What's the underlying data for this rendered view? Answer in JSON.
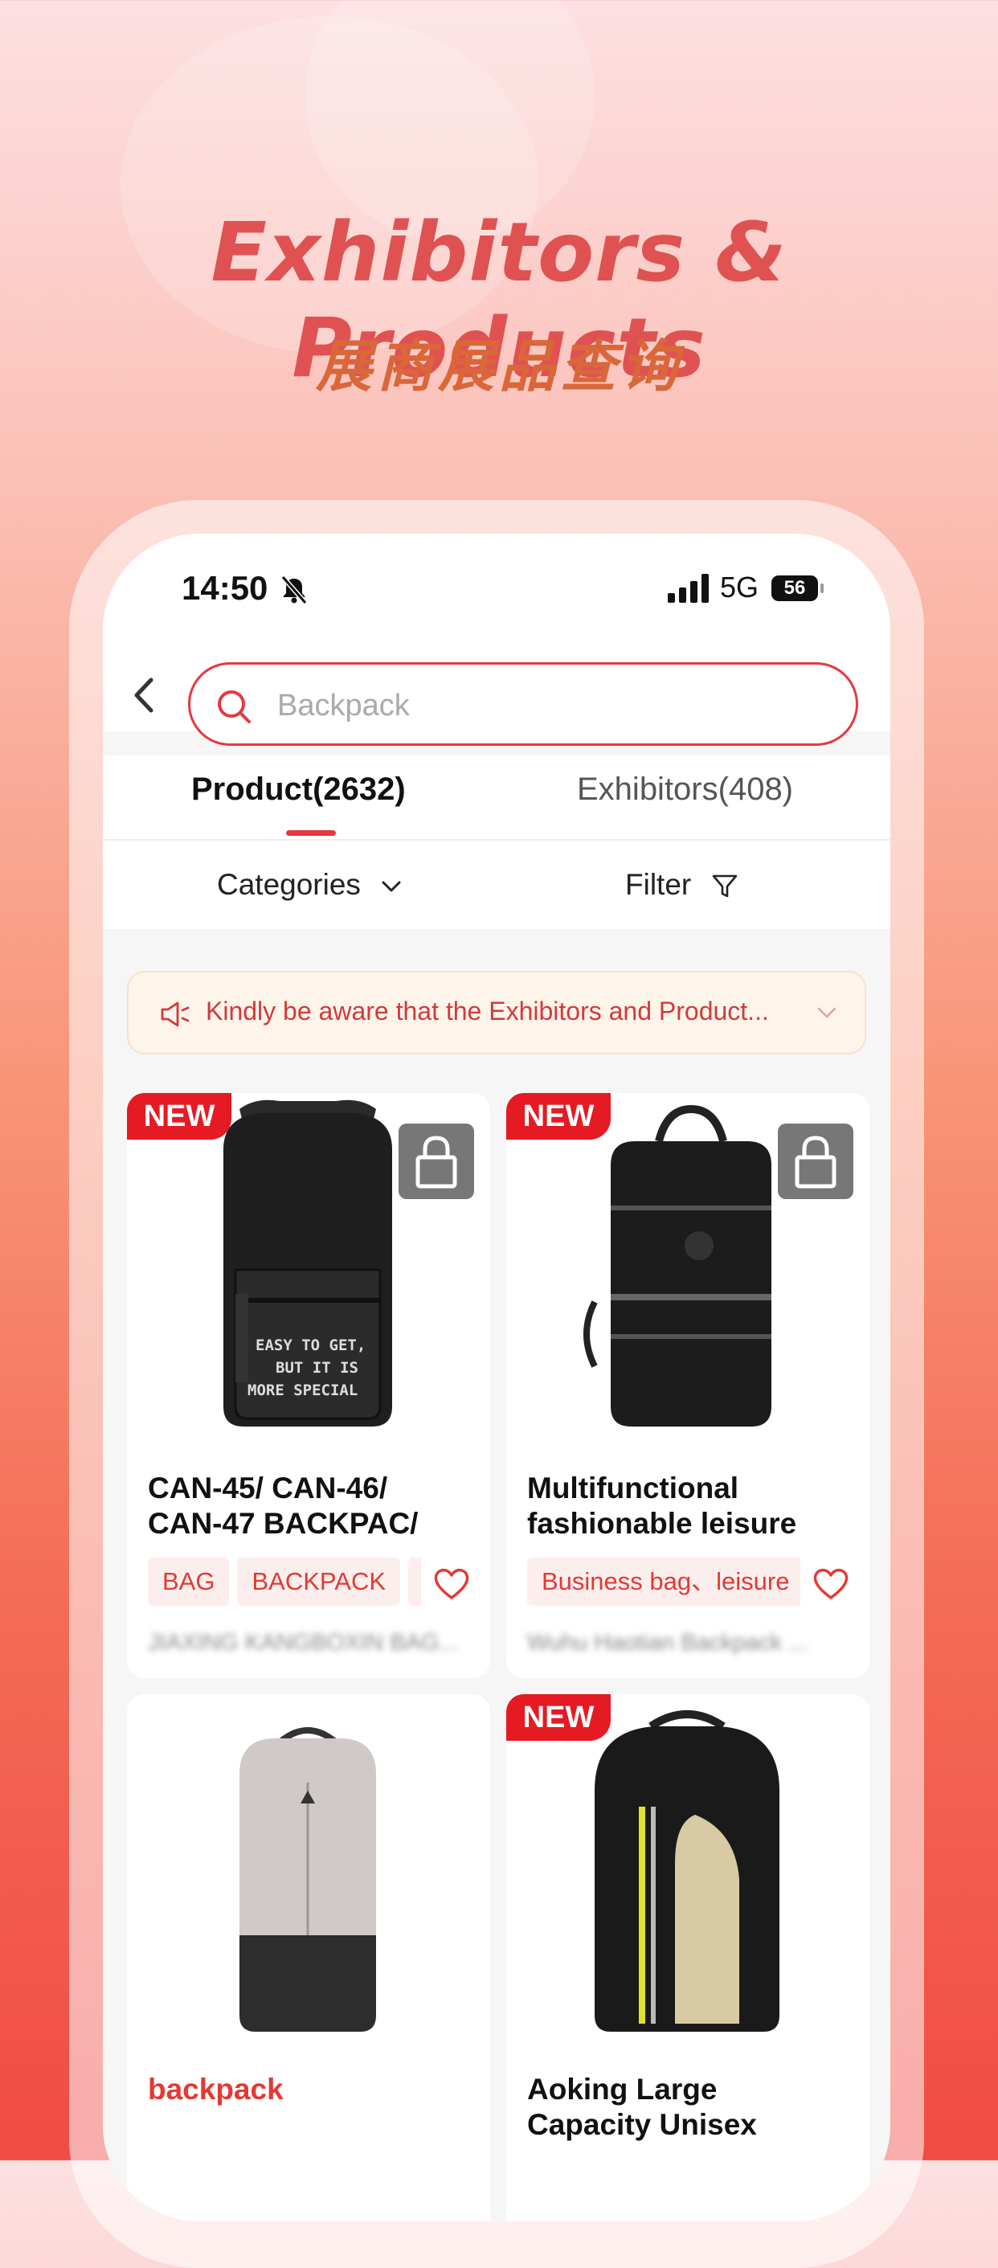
{
  "hero": {
    "title": "Exhibitors & Products",
    "subtitle": "展商展品查询"
  },
  "status_bar": {
    "time": "14:50",
    "network": "5G",
    "battery": "56"
  },
  "search": {
    "placeholder": "Backpack"
  },
  "tabs": [
    {
      "label": "Product(2632)",
      "active": true
    },
    {
      "label": "Exhibitors(408)",
      "active": false
    }
  ],
  "filters": {
    "categories_label": "Categories",
    "filter_label": "Filter"
  },
  "notice": {
    "text": "Kindly be aware that the Exhibitors and Product..."
  },
  "products": [
    {
      "badge": "NEW",
      "title": "CAN-45/ CAN-46/ CAN-47 BACKPAC/",
      "tags": [
        "BAG",
        "BACKPACK",
        "C"
      ],
      "exhibitor": "JIAXING KANGBOXIN BAG..."
    },
    {
      "badge": "NEW",
      "title": "Multifunctional fashionable leisure",
      "tags": [
        "Business bag、leisure"
      ],
      "exhibitor": "Wuhu Haotian Backpack ..."
    },
    {
      "badge": "",
      "title": "backpack",
      "tags": [],
      "exhibitor": ""
    },
    {
      "badge": "NEW",
      "title": "Aoking Large Capacity Unisex",
      "tags": [],
      "exhibitor": ""
    }
  ],
  "colors": {
    "accent": "#e5393f",
    "badge": "#e51a23",
    "hero_title": "#e05252",
    "hero_subtitle": "#d9673a"
  }
}
